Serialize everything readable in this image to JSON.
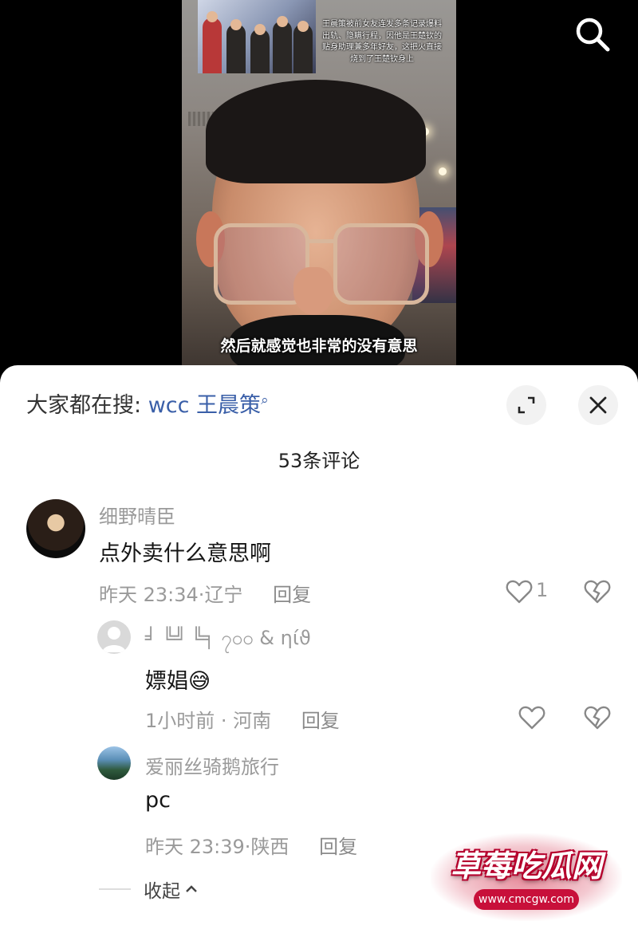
{
  "video": {
    "overlay_caption": "王晨策被前女友连发多条记录爆料出轨、隐瞒行程，因他是王楚钦的贴身助理兼多年好友，这把火直接烧到了王楚钦身上",
    "subtitle": "然后就感觉也非常的没有意思"
  },
  "header": {
    "trending_label": "大家都在搜:",
    "trending_term": "wcc 王晨策",
    "search_icon": "search-icon",
    "expand_icon": "expand-icon",
    "close_icon": "close-icon"
  },
  "comments_title": "53条评论",
  "comments": [
    {
      "username": "细野晴臣",
      "text": "点外卖什么意思啊",
      "time": "昨天 23:34",
      "location": "辽宁",
      "reply_label": "回复",
      "likes": "1",
      "replies": [
        {
          "username": "╛ ╚╝ ╚╕ ၇၀၀ & ηίϑ",
          "text": "嫖娼",
          "emoji": "😅",
          "time": "1小时前",
          "location": "河南",
          "reply_label": "回复"
        },
        {
          "username": "爱丽丝骑鹅旅行",
          "text": "pc",
          "time": "昨天 23:39",
          "location": "陕西",
          "reply_label": "回复"
        }
      ]
    }
  ],
  "collapse_label": "收起",
  "watermark": {
    "title": "草莓吃瓜网",
    "url": "www.cmcgw.com"
  },
  "colors": {
    "accent_link": "#3a5fa8",
    "meta_gray": "#9a9a9a",
    "watermark_red": "#c8103a"
  }
}
